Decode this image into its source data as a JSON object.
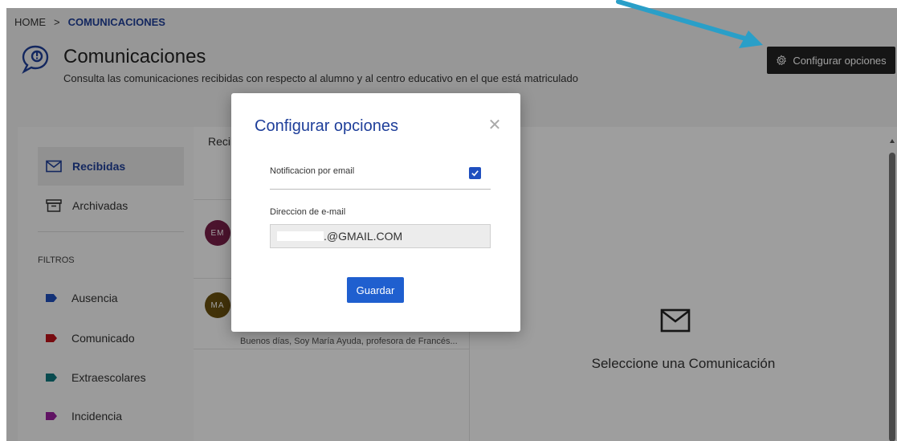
{
  "breadcrumb": {
    "home": "HOME",
    "separator": ">",
    "current": "COMUNICACIONES"
  },
  "header": {
    "title": "Comunicaciones",
    "subtitle": "Consulta las comunicaciones recibidas con respecto al alumno y al centro educativo en el que está matriculado",
    "icon": "chat-alert-icon",
    "config_button": "Configurar opciones",
    "config_icon": "gear-icon"
  },
  "sidebar": {
    "items": [
      {
        "label": "Recibidas",
        "icon": "envelope-icon",
        "active": true
      },
      {
        "label": "Archivadas",
        "icon": "archive-icon",
        "active": false
      }
    ],
    "filters_label": "FILTROS",
    "filters": [
      {
        "label": "Ausencia",
        "color": "#1f4fbf"
      },
      {
        "label": "Comunicado",
        "color": "#c0121b"
      },
      {
        "label": "Extraescolares",
        "color": "#0f7a80"
      },
      {
        "label": "Incidencia",
        "color": "#9c1fa0"
      }
    ]
  },
  "list": {
    "title": "Recib",
    "items": [
      {
        "initials": "EM",
        "color": "#7a1f4a"
      },
      {
        "initials": "MA",
        "color": "#6b5210",
        "preview": "Buenos días, Soy María Ayuda, profesora de Francés..."
      }
    ]
  },
  "detail": {
    "empty_text": "Seleccione una Comunicación",
    "icon": "envelope-icon"
  },
  "modal": {
    "title": "Configurar opciones",
    "close_icon": "close-icon",
    "notification_label": "Notificacion por email",
    "notification_checked": true,
    "email_label": "Direccion de e-mail",
    "email_value": ".@GMAIL.COM",
    "save_button": "Guardar"
  },
  "colors": {
    "accent": "#1f3f9a",
    "button_dark": "#232323",
    "save_button": "#1f5fcf",
    "annotation_arrow": "#2a9fc8"
  }
}
